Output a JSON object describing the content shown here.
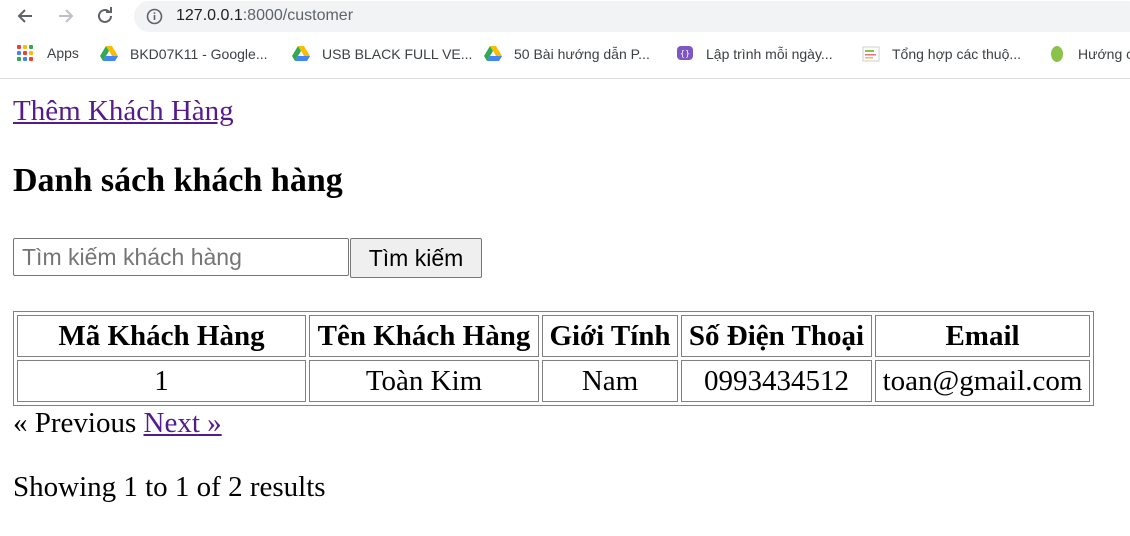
{
  "browser": {
    "url_host": "127.0.0.1",
    "url_rest": ":8000/customer",
    "bookmarks": [
      {
        "label": "Apps",
        "icon": "apps-grid-icon"
      },
      {
        "label": "BKD07K11 - Google...",
        "icon": "google-drive-icon"
      },
      {
        "label": "USB BLACK FULL VE...",
        "icon": "google-drive-icon"
      },
      {
        "label": "50 Bài hướng dẫn P...",
        "icon": "google-drive-icon"
      },
      {
        "label": "Lập trình mỗi ngày...",
        "icon": "code-bubble-icon"
      },
      {
        "label": "Tổng hợp các thuộ...",
        "icon": "page-thumbnail-icon"
      },
      {
        "label": "Hướng c",
        "icon": "leaf-icon"
      }
    ]
  },
  "page": {
    "add_link": "Thêm Khách Hàng",
    "title": "Danh sách khách hàng",
    "search": {
      "placeholder": "Tìm kiếm khách hàng",
      "value": "",
      "button": "Tìm kiếm"
    },
    "table": {
      "headers": [
        "Mã Khách Hàng",
        "Tên Khách Hàng",
        "Giới Tính",
        "Số Điện Thoại",
        "Email"
      ],
      "rows": [
        [
          "1",
          "Toàn Kim",
          "Nam",
          "0993434512",
          "toan@gmail.com"
        ]
      ]
    },
    "pagination": {
      "previous": "« Previous",
      "next": "Next »"
    },
    "results_text": "Showing 1 to 1 of 2 results"
  },
  "colors": {
    "link": "#551a8b",
    "chrome_bg": "#f1f3f4"
  }
}
